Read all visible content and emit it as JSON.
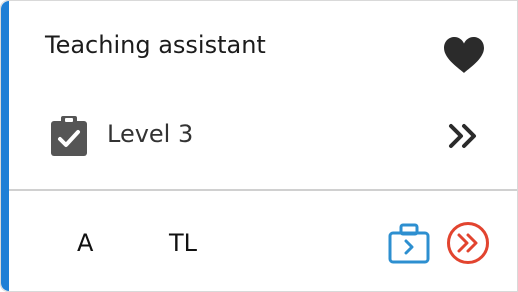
{
  "card": {
    "title": "Teaching assistant",
    "level_label": "Level 3",
    "tags": [
      "A",
      "TL"
    ]
  },
  "icons": {
    "favorite": "heart-icon",
    "level": "clipboard-check-icon",
    "expand": "double-chevron-right-icon",
    "workplace": "briefcase-arrow-icon",
    "go": "circle-double-chevron-icon"
  },
  "colors": {
    "accent": "#1f7fd6",
    "briefcase": "#2d8fd0",
    "go": "#e2442f",
    "text": "#1c1c1c"
  }
}
